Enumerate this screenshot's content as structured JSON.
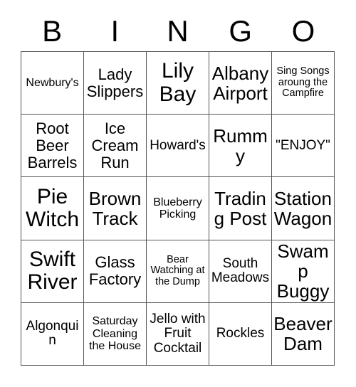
{
  "card": {
    "header_letters": [
      "B",
      "I",
      "N",
      "G",
      "O"
    ],
    "columns": 5,
    "rows": 5,
    "border_color": "#555555",
    "background_color": "#ffffff",
    "text_color": "#000000",
    "cells": [
      {
        "text": "Newbury's",
        "size": "sm"
      },
      {
        "text": "Lady Slippers",
        "size": "lg"
      },
      {
        "text": "Lily Bay",
        "size": "xxl"
      },
      {
        "text": "Albany Airport",
        "size": "xl"
      },
      {
        "text": "Sing Songs aroung the Campfire",
        "size": "xs"
      },
      {
        "text": "Root Beer Barrels",
        "size": "lg"
      },
      {
        "text": "Ice Cream Run",
        "size": "lg"
      },
      {
        "text": "Howard's",
        "size": "md"
      },
      {
        "text": "Rummy",
        "size": "xl"
      },
      {
        "text": "\"ENJOY\"",
        "size": "md"
      },
      {
        "text": "Pie Witch",
        "size": "xxl"
      },
      {
        "text": "Brown Track",
        "size": "xl"
      },
      {
        "text": "Blueberry Picking",
        "size": "sm"
      },
      {
        "text": "Trading Post",
        "size": "xl"
      },
      {
        "text": "Station Wagon",
        "size": "xl"
      },
      {
        "text": "Swift River",
        "size": "xxl"
      },
      {
        "text": "Glass Factory",
        "size": "lg"
      },
      {
        "text": "Bear Watching at the Dump",
        "size": "xs"
      },
      {
        "text": "South Meadows",
        "size": "md"
      },
      {
        "text": "Swamp Buggy",
        "size": "xl"
      },
      {
        "text": "Algonquin",
        "size": "md"
      },
      {
        "text": "Saturday Cleaning the House",
        "size": "sm"
      },
      {
        "text": "Jello with Fruit Cocktail",
        "size": "md"
      },
      {
        "text": "Rockles",
        "size": "md"
      },
      {
        "text": "Beaver Dam",
        "size": "xl"
      }
    ]
  }
}
